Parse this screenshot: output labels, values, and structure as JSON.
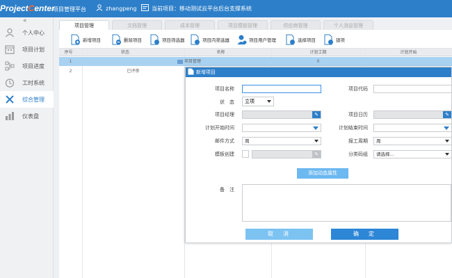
{
  "header": {
    "logo_a": "Project",
    "logo_b": "C",
    "logo_c": "enter",
    "subtitle": "项目管理平台",
    "username": "zhangpeng",
    "current_project": "当前项目：移动测试云平台后台支撑系统"
  },
  "sidebar": {
    "collapse": "«",
    "items": [
      {
        "label": "个人中心",
        "icon": "user-icon"
      },
      {
        "label": "项目计划",
        "icon": "calendar-icon"
      },
      {
        "label": "项目进度",
        "icon": "network-icon"
      },
      {
        "label": "工时系统",
        "icon": "clock-icon"
      },
      {
        "label": "综合管理",
        "icon": "tools-icon"
      },
      {
        "label": "仪表盘",
        "icon": "chart-icon"
      }
    ],
    "active_index": 4
  },
  "tabs": [
    "项目管理",
    "文档管理",
    "成本管理",
    "项目模板管理",
    "供应商管理",
    "个人消息管理"
  ],
  "toolbar": [
    "新增项目",
    "删除项目",
    "项目筛选器",
    "项目内筛选器",
    "项目用户管理",
    "选择项目",
    "锁项"
  ],
  "grid": {
    "headers": [
      "序号",
      "状态",
      "名称",
      "计划工期",
      "计划开始"
    ],
    "rows": [
      {
        "no": "1",
        "status": "",
        "name": "项目管理",
        "duration": "0",
        "start": ""
      },
      {
        "no": "2",
        "status": "已评审",
        "name": "",
        "duration": "",
        "start": ""
      }
    ]
  },
  "modal": {
    "title": "新增项目",
    "fields": {
      "name_label": "项目名称",
      "code_label": "项目代码",
      "status_label": "状　态",
      "status_value": "立项",
      "manager_label": "项目经理",
      "calendar_label": "项目日历",
      "plan_start_label": "计划开始时间",
      "plan_end_label": "计划结束时间",
      "mail_label": "邮件方式",
      "mail_value": "周",
      "report_label": "报工周期",
      "report_value": "周",
      "template_label": "模板创建",
      "category_label": "分类码组",
      "category_value": "请选择...",
      "remarks_label": "备　注"
    },
    "add_attr": "添加动态属性",
    "cancel": "取　消",
    "ok": "确　定"
  },
  "colors": {
    "header_bg": "#2d7fc9",
    "accent": "#2d86d6",
    "selected_row": "#a9d2f2"
  }
}
